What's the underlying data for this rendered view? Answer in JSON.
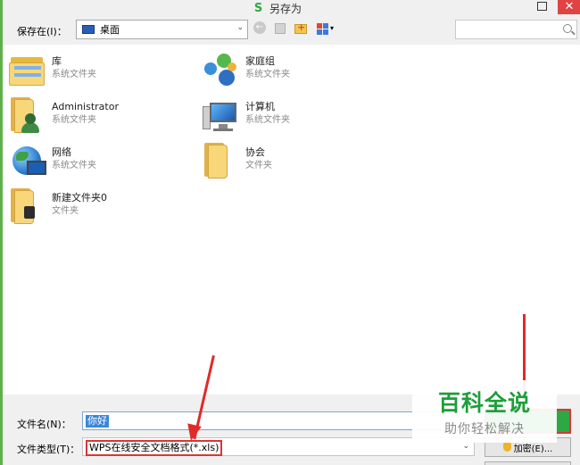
{
  "window": {
    "title": "另存为",
    "close_glyph": "✕"
  },
  "toolbar": {
    "save_in_label": "保存在(I)：",
    "location": "桌面",
    "back_glyph": "←",
    "search_placeholder": ""
  },
  "files": [
    {
      "name": "库",
      "type": "系统文件夹",
      "icon": "library-icon"
    },
    {
      "name": "家庭组",
      "type": "系统文件夹",
      "icon": "homegroup-icon"
    },
    {
      "name": "Administrator",
      "type": "系统文件夹",
      "icon": "user-folder-icon"
    },
    {
      "name": "计算机",
      "type": "系统文件夹",
      "icon": "computer-icon"
    },
    {
      "name": "网络",
      "type": "系统文件夹",
      "icon": "network-icon"
    },
    {
      "name": "协会",
      "type": "文件夹",
      "icon": "folder-icon"
    },
    {
      "name": "新建文件夹0",
      "type": "文件夹",
      "icon": "locked-folder-icon"
    }
  ],
  "bottom": {
    "filename_label": "文件名(N)：",
    "filename_value": "你好",
    "filetype_label": "文件类型(T)：",
    "filetype_value": "WPS在线安全文档格式(*.xls)",
    "encrypt_label": "加密(E)..."
  },
  "watermark": {
    "title": "百科全说",
    "subtitle": "助你轻松解决"
  },
  "colors": {
    "accent_green": "#2ea845",
    "annotation_red": "#e02a2a",
    "close_red": "#e04343"
  }
}
